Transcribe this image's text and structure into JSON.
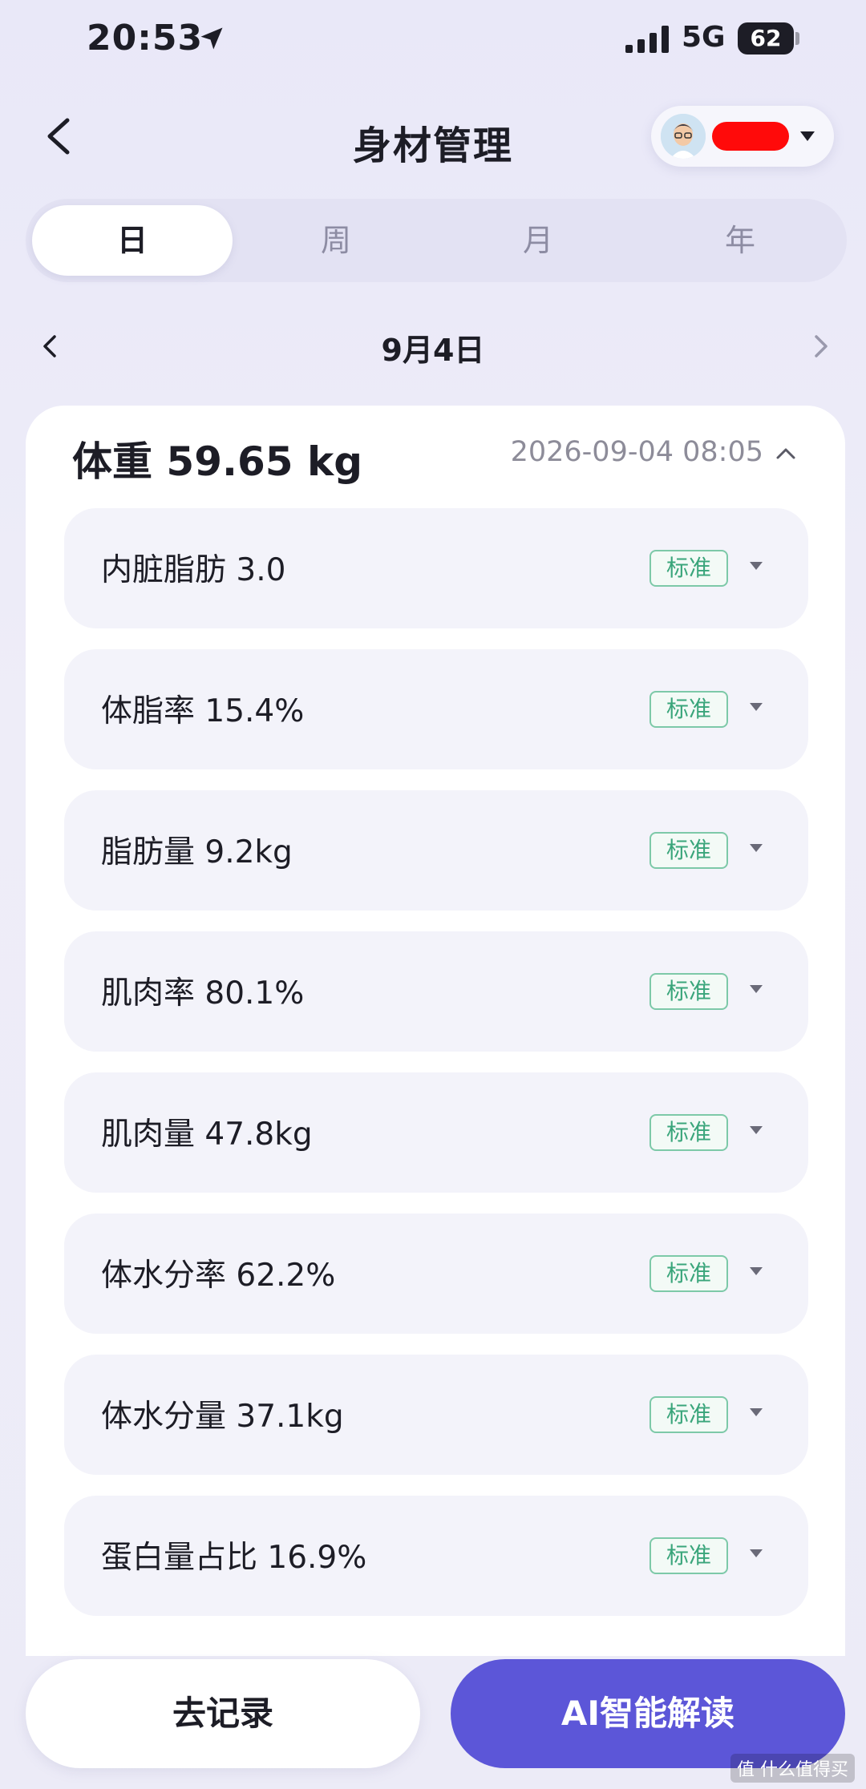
{
  "status_bar": {
    "time": "20:53",
    "network": "5G",
    "battery": "62"
  },
  "header": {
    "title": "身材管理"
  },
  "tabs": [
    {
      "label": "日",
      "active": true
    },
    {
      "label": "周",
      "active": false
    },
    {
      "label": "月",
      "active": false
    },
    {
      "label": "年",
      "active": false
    }
  ],
  "date_nav": {
    "label": "9月4日"
  },
  "record": {
    "weight_title": "体重 59.65 kg",
    "time": "2026-09-04 08:05",
    "metrics": [
      {
        "text": "内脏脂肪 3.0",
        "badge": "标准"
      },
      {
        "text": "体脂率 15.4%",
        "badge": "标准"
      },
      {
        "text": "脂肪量 9.2kg",
        "badge": "标准"
      },
      {
        "text": "肌肉率 80.1%",
        "badge": "标准"
      },
      {
        "text": "肌肉量 47.8kg",
        "badge": "标准"
      },
      {
        "text": "体水分率 62.2%",
        "badge": "标准"
      },
      {
        "text": "体水分量 37.1kg",
        "badge": "标准"
      },
      {
        "text": "蛋白量占比 16.9%",
        "badge": "标准"
      }
    ]
  },
  "actions": {
    "record_label": "去记录",
    "ai_label": "AI智能解读"
  },
  "watermark": "值 什么值得买",
  "colors": {
    "accent": "#5c56d8",
    "badge_green": "#3aa57b",
    "redaction": "#ff0a0a"
  }
}
